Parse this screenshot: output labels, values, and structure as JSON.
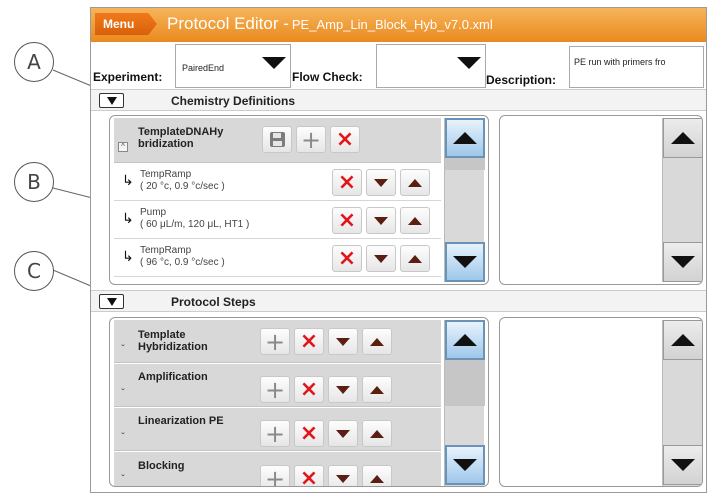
{
  "window": {
    "menu_label": "Menu",
    "title": "Protocol Editor -",
    "filename": "PE_Amp_Lin_Block_Hyb_v7.0.xml"
  },
  "callouts": [
    "A",
    "B",
    "C"
  ],
  "experiment": {
    "experiment_label": "Experiment:",
    "experiment_value": "PairedEnd",
    "flow_check_label": "Flow Check:",
    "flow_check_value": "",
    "description_label": "Description:",
    "description_value": "PE run with primers fro"
  },
  "chemistry": {
    "section_title": "Chemistry Definitions",
    "group": {
      "name_line1": "TemplateDNAHy",
      "name_line2": "bridization",
      "expand_glyph": "^"
    },
    "steps": [
      {
        "name": "TempRamp",
        "params": "( 20 °c, 0.9 °c/sec )"
      },
      {
        "name": "Pump",
        "params": "( 60 μL/m, 120 μL, HT1 )"
      },
      {
        "name": "TempRamp",
        "params": "( 96 °c, 0.9 °c/sec )"
      }
    ]
  },
  "protocol": {
    "section_title": "Protocol Steps",
    "groups": [
      {
        "name_line1": "Template",
        "name_line2": "Hybridization"
      },
      {
        "name_line1": "Amplification",
        "name_line2": ""
      },
      {
        "name_line1": "Linearization PE",
        "name_line2": ""
      },
      {
        "name_line1": "Blocking",
        "name_line2": ""
      }
    ],
    "expand_glyph": "ˇ"
  },
  "icons": {
    "delete": "×",
    "add": "+",
    "move_down": "triangle-down",
    "move_up": "triangle-up",
    "save": "floppy-disk",
    "hook": "↳"
  },
  "colors": {
    "titlebar": "#e98a1f",
    "menu": "#d9600a",
    "delete": "#e0161b",
    "arrows": "#5a1e12",
    "scroll_active": "#9ec7ea"
  }
}
